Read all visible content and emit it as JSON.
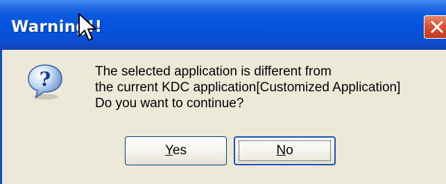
{
  "window": {
    "title": "Warning!!",
    "close_icon": "close-icon"
  },
  "message": {
    "icon": "question-icon",
    "lines": [
      "The selected application is different from",
      "the current KDC application[Customized Application]",
      "Do you want to continue?"
    ]
  },
  "buttons": {
    "yes": {
      "accesskey": "Y",
      "rest": "es"
    },
    "no": {
      "accesskey": "N",
      "rest": "o"
    }
  },
  "colors": {
    "titlebar": "#0550dc",
    "dialog_bg": "#ece9d8",
    "close_button": "#d6553a",
    "focus_border": "#1d50b8"
  }
}
